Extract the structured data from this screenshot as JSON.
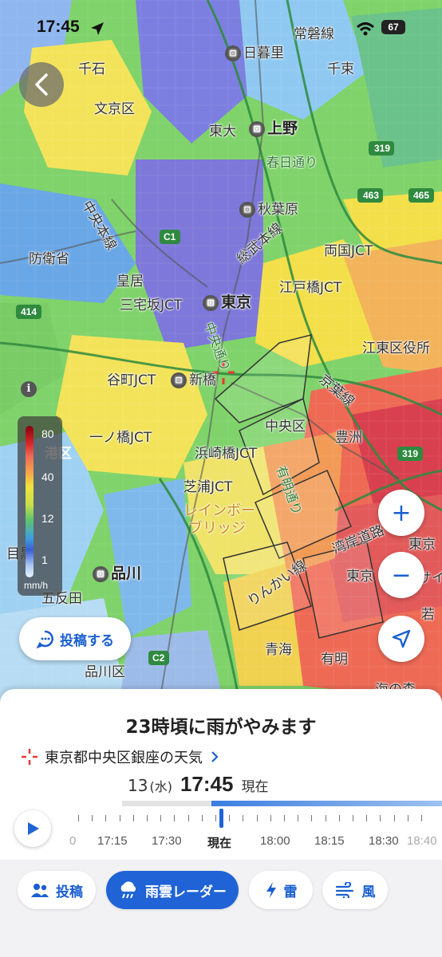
{
  "status_bar": {
    "time": "17:45",
    "battery": "67"
  },
  "map": {
    "places": [
      {
        "name": "千石",
        "cls": ""
      },
      {
        "name": "文京区",
        "cls": ""
      },
      {
        "name": "日暮里",
        "cls": "station"
      },
      {
        "name": "千束",
        "cls": ""
      },
      {
        "name": "常磐線",
        "cls": ""
      },
      {
        "name": "東大",
        "cls": ""
      },
      {
        "name": "上野",
        "cls": "station big"
      },
      {
        "name": "春日通り",
        "cls": "road"
      },
      {
        "name": "秋葉原",
        "cls": "station"
      },
      {
        "name": "中央本線",
        "cls": ""
      },
      {
        "name": "総武本線",
        "cls": ""
      },
      {
        "name": "防衛省",
        "cls": ""
      },
      {
        "name": "両国JCT",
        "cls": ""
      },
      {
        "name": "皇居",
        "cls": ""
      },
      {
        "name": "江戸橋JCT",
        "cls": ""
      },
      {
        "name": "三宅坂JCT",
        "cls": ""
      },
      {
        "name": "東京",
        "cls": "station big"
      },
      {
        "name": "江東区役所",
        "cls": ""
      },
      {
        "name": "谷町JCT",
        "cls": ""
      },
      {
        "name": "新橋",
        "cls": "station"
      },
      {
        "name": "京葉線",
        "cls": ""
      },
      {
        "name": "港区",
        "cls": ""
      },
      {
        "name": "中央区",
        "cls": ""
      },
      {
        "name": "豊洲",
        "cls": ""
      },
      {
        "name": "一ノ橋JCT",
        "cls": ""
      },
      {
        "name": "浜崎橋JCT",
        "cls": ""
      },
      {
        "name": "芝浦JCT",
        "cls": ""
      },
      {
        "name": "レインボー",
        "cls": "orange"
      },
      {
        "name": "ブリッジ",
        "cls": "orange"
      },
      {
        "name": "湾岸道路",
        "cls": ""
      },
      {
        "name": "目黒",
        "cls": ""
      },
      {
        "name": "品川",
        "cls": "station big"
      },
      {
        "name": "りんかい線",
        "cls": ""
      },
      {
        "name": "東京",
        "cls": ""
      },
      {
        "name": "五反田",
        "cls": ""
      },
      {
        "name": "青海",
        "cls": ""
      },
      {
        "name": "有明",
        "cls": ""
      },
      {
        "name": "品川区",
        "cls": ""
      },
      {
        "name": "東京",
        "cls": ""
      },
      {
        "name": "若",
        "cls": ""
      },
      {
        "name": "海の森",
        "cls": ""
      },
      {
        "name": "有明通り",
        "cls": "road"
      },
      {
        "name": "中央通り",
        "cls": "road"
      },
      {
        "name": "サイ",
        "cls": ""
      }
    ],
    "road_shields": [
      "319",
      "463",
      "465",
      "414",
      "C1",
      "C2",
      "319"
    ]
  },
  "legend": {
    "ticks": [
      "80",
      "40",
      "12",
      "1"
    ],
    "unit": "mm/h"
  },
  "post_button": {
    "label": "投稿する"
  },
  "zoom": {
    "in": "+",
    "out": "−"
  },
  "sheet": {
    "headline": "23時頃に雨がやみます",
    "location": "東京都中央区銀座の天気",
    "date": "13",
    "weekday": "(水)",
    "time": "17:45",
    "state": "現在",
    "timeline_labels": [
      "0",
      "17:15",
      "17:30",
      "現在",
      "18:00",
      "18:15",
      "18:30",
      "18:40"
    ]
  },
  "nav": {
    "items": [
      {
        "label": "投稿",
        "icon": "people-icon",
        "active": false
      },
      {
        "label": "雨雲レーダー",
        "icon": "rain-cloud-icon",
        "active": true
      },
      {
        "label": "雷",
        "icon": "lightning-icon",
        "active": false
      },
      {
        "label": "風",
        "icon": "wind-icon",
        "active": false
      }
    ]
  },
  "colors": {
    "accent": "#1f63d6",
    "rain_light": "#5fc46b",
    "rain_moderate": "#f1e23c",
    "rain_heavy": "#ee6a55"
  }
}
